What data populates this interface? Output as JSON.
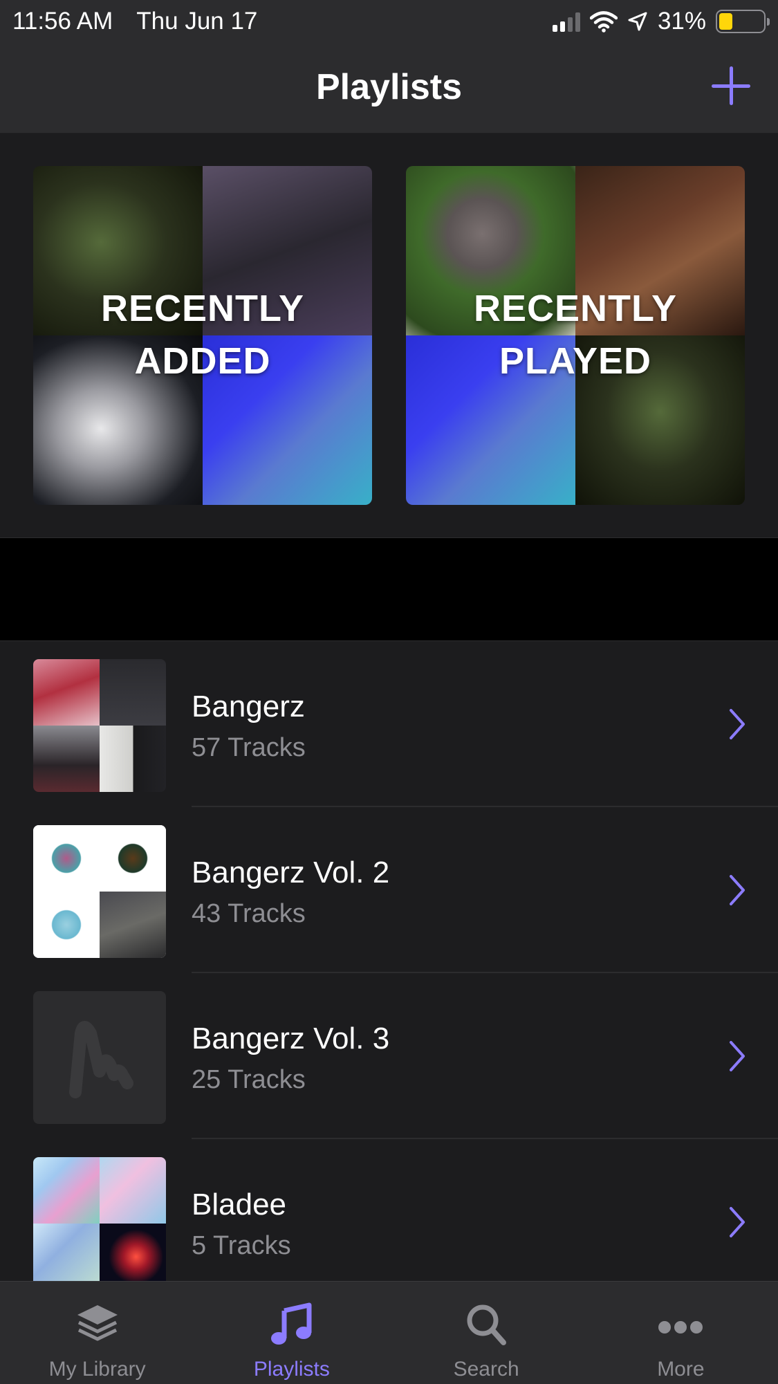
{
  "status_bar": {
    "time": "11:56 AM",
    "date": "Thu Jun 17",
    "battery_percent": "31%",
    "battery_level": 0.31,
    "battery_color": "#ffd60a"
  },
  "nav": {
    "title": "Playlists",
    "add_icon": "plus-icon"
  },
  "featured": [
    {
      "label": "RECENTLY\nADDED"
    },
    {
      "label": "RECENTLY\nPLAYED"
    }
  ],
  "playlists": [
    {
      "name": "Bangerz",
      "count": "57 Tracks"
    },
    {
      "name": "Bangerz Vol. 2",
      "count": "43 Tracks"
    },
    {
      "name": "Bangerz Vol. 3",
      "count": "25 Tracks"
    },
    {
      "name": "Bladee",
      "count": "5 Tracks"
    }
  ],
  "tabs": [
    {
      "label": "My Library",
      "icon": "stack-icon"
    },
    {
      "label": "Playlists",
      "icon": "music-note-icon",
      "active": true
    },
    {
      "label": "Search",
      "icon": "search-icon"
    },
    {
      "label": "More",
      "icon": "more-icon"
    }
  ],
  "colors": {
    "accent": "#8c7cff",
    "background": "#1c1c1e",
    "bar": "#2c2c2e",
    "secondary_text": "#8e8e93"
  }
}
